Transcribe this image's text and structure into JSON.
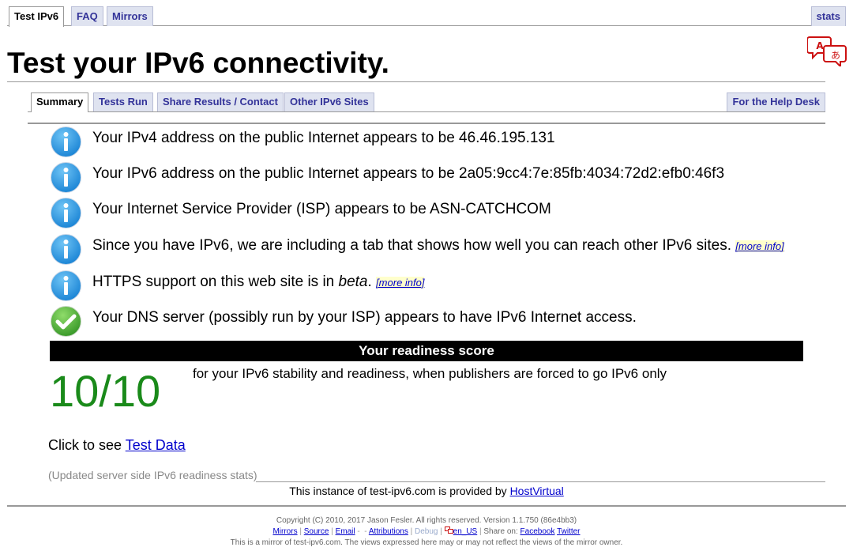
{
  "topnav": {
    "tabs": [
      "Test IPv6",
      "FAQ",
      "Mirrors"
    ],
    "stats": "stats"
  },
  "title": "Test your IPv6 connectivity.",
  "subnav": {
    "tabs": [
      "Summary",
      "Tests Run",
      "Share Results / Contact",
      "Other IPv6 Sites"
    ],
    "helpdesk": "For the Help Desk"
  },
  "results": {
    "ipv4": "Your IPv4 address on the public Internet appears to be 46.46.195.131",
    "ipv6": "Your IPv6 address on the public Internet appears to be 2a05:9cc4:7e:85fb:4034:72d2:efb0:46f3",
    "isp": "Your Internet Service Provider (ISP) appears to be ASN-CATCHCOM",
    "tab_note": "Since you have IPv6, we are including a tab that shows how well you can reach other IPv6 sites.",
    "https_a": "HTTPS support on this web site is in ",
    "https_em": "beta",
    "https_b": ".",
    "dns": "Your DNS server (possibly run by your ISP) appears to have IPv6 Internet access.",
    "more_info": "[more info]"
  },
  "score": {
    "heading": "Your readiness score",
    "value": "10/10",
    "description": "for your IPv6 stability and readiness, when publishers are forced to go IPv6 only",
    "color": "#1a8a1a"
  },
  "testdata": {
    "prefix": "Click to see ",
    "link": "Test Data"
  },
  "updated": "(Updated server side IPv6 readiness stats)",
  "instance": {
    "prefix": "This instance of test-ipv6.com is provided by ",
    "link": "HostVirtual"
  },
  "footer": {
    "copyright": "Copyright (C) 2010, 2017 Jason Fesler. All rights reserved. Version 1.1.750 (86e4bb3)",
    "links": [
      "Mirrors",
      "Source",
      "Email",
      "Attributions",
      "Debug",
      "en_US"
    ],
    "share_label": "Share on:",
    "share": [
      "Facebook",
      "Twitter"
    ],
    "mirror_note": "This is a mirror of test-ipv6.com. The views expressed here may or may not reflect the views of the mirror owner."
  }
}
